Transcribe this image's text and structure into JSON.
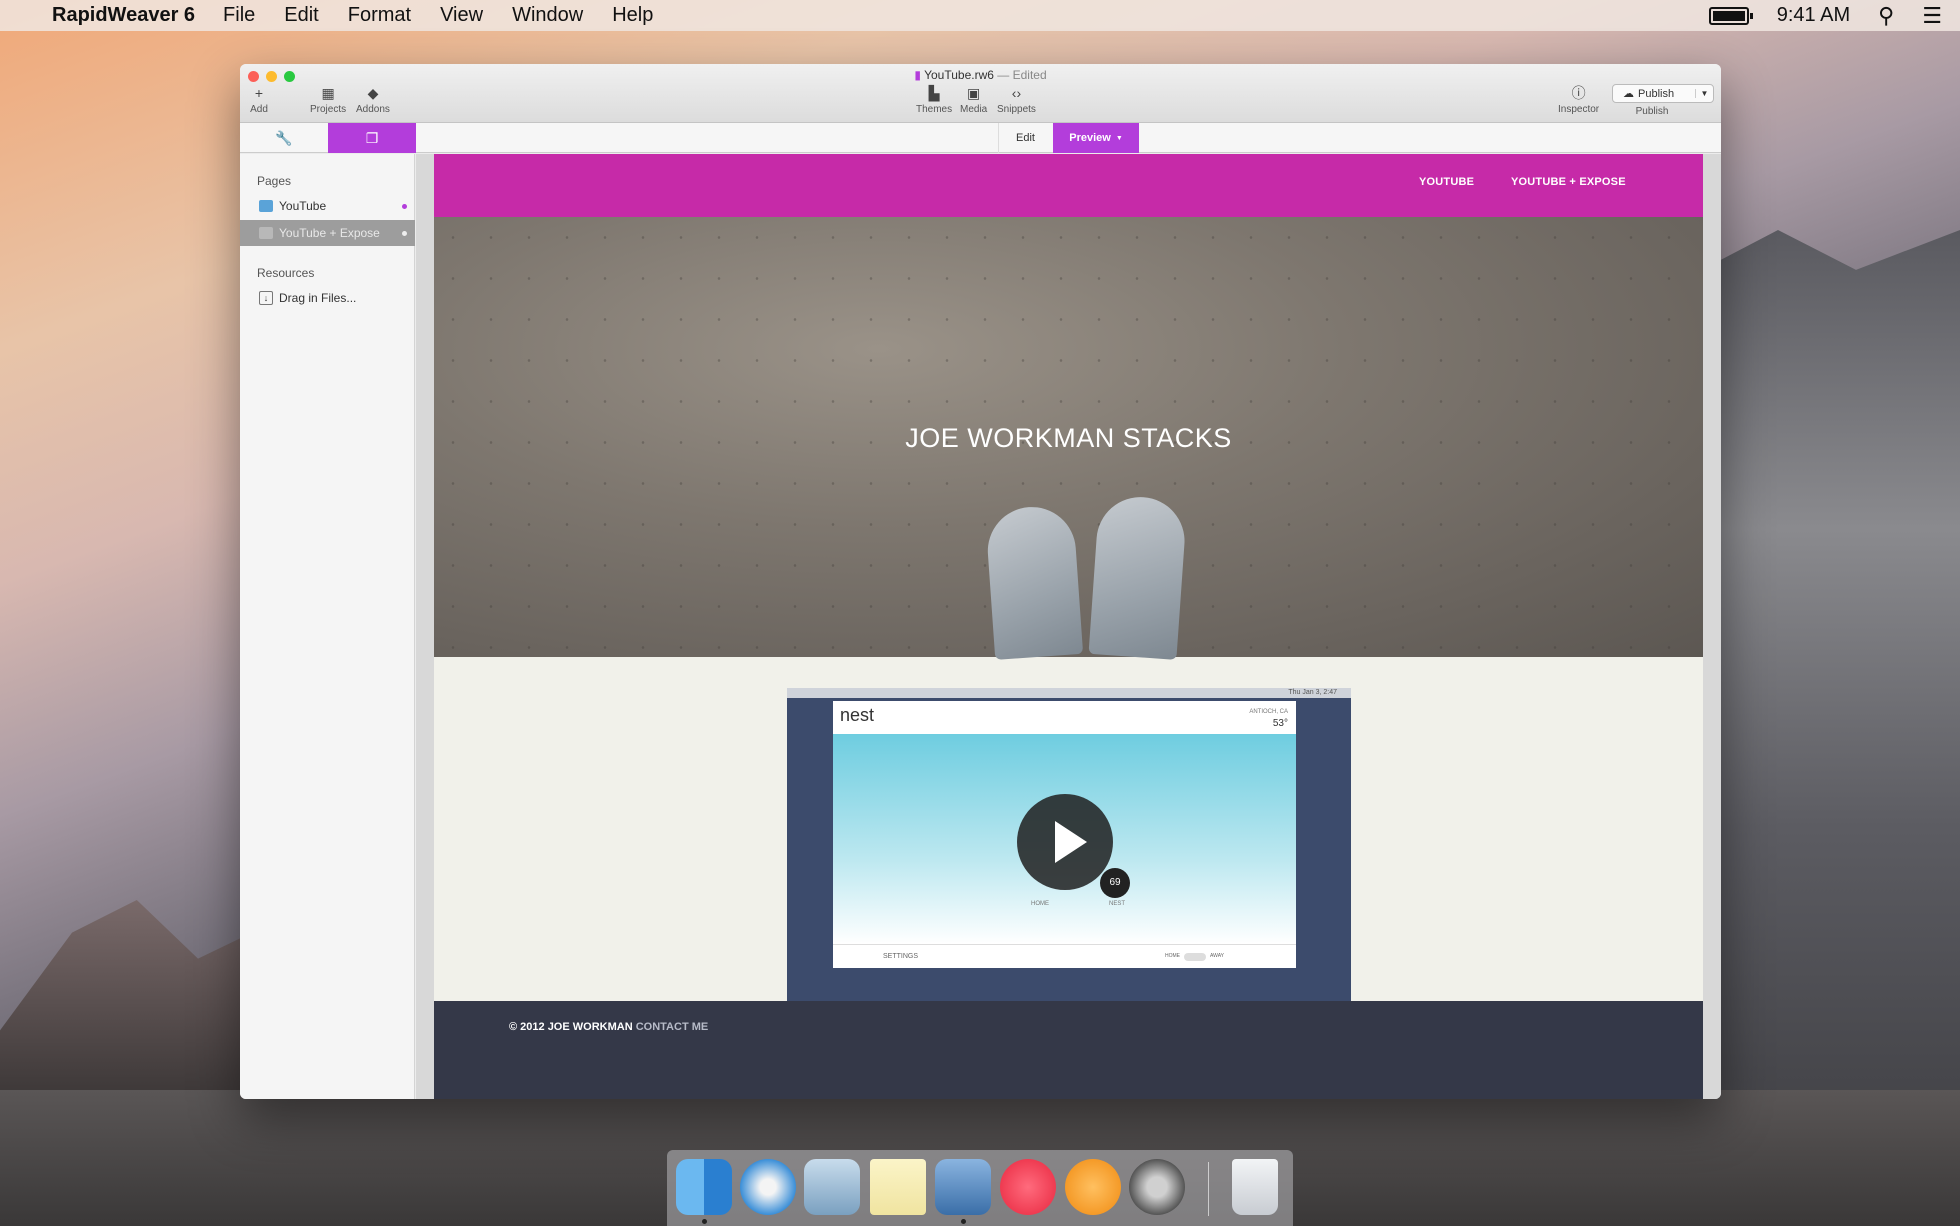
{
  "menubar": {
    "app_name": "RapidWeaver 6",
    "menus": [
      "File",
      "Edit",
      "Format",
      "View",
      "Window",
      "Help"
    ],
    "time": "9:41 AM"
  },
  "window": {
    "doc_name": "YouTube.rw6",
    "doc_status": "— Edited",
    "toolbar": {
      "add": "Add",
      "projects": "Projects",
      "addons": "Addons",
      "themes": "Themes",
      "media": "Media",
      "snippets": "Snippets",
      "inspector": "Inspector",
      "publish_button": "Publish",
      "publish_label": "Publish"
    },
    "modes": {
      "edit": "Edit",
      "preview": "Preview"
    },
    "accent_color": "#b33ddb"
  },
  "sidebar": {
    "pages_heading": "Pages",
    "pages": [
      {
        "label": "YouTube",
        "selected": false
      },
      {
        "label": "YouTube + Expose",
        "selected": true
      }
    ],
    "resources_heading": "Resources",
    "drag_in": "Drag in Files..."
  },
  "site": {
    "nav": [
      "YOUTUBE",
      "YOUTUBE + EXPOSE"
    ],
    "nav_color": "#c62aa8",
    "hero_title": "JOE WORKMAN STACKS",
    "video": {
      "logo": "nest",
      "temp_city": "ANTIOCH, CA",
      "temp": "53°",
      "status_time": "Thu Jan 3, 2:47",
      "target": "69",
      "home_label": "HOME",
      "nest_label": "NEST",
      "settings": "SETTINGS",
      "switch_home": "HOME",
      "switch_away": "AWAY"
    },
    "footer": {
      "copyright": "© 2012 JOE WORKMAN",
      "contact": "CONTACT ME"
    }
  },
  "dock": {
    "apps": [
      "finder-icon",
      "safari-icon",
      "mail-icon",
      "notes-icon",
      "xcode-icon",
      "itunes-icon",
      "ibooks-icon",
      "system-preferences-icon",
      "trash-icon"
    ]
  }
}
